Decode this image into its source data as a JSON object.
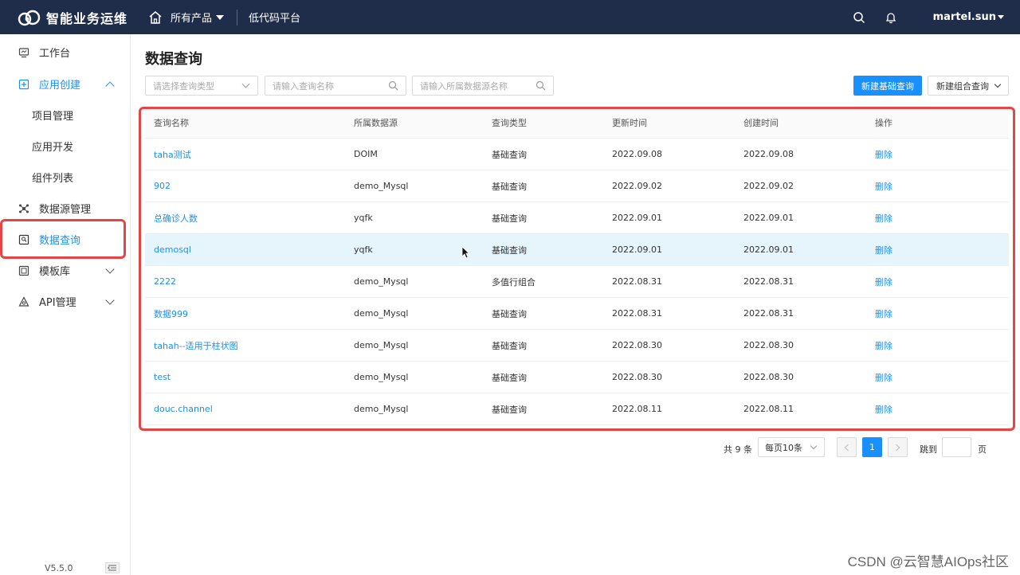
{
  "topbar": {
    "brand": "智能业务运维",
    "products": "所有产品",
    "platform": "低代码平台",
    "username": "martel.sun",
    "bg_color": "#1f2d4a"
  },
  "sidebar": {
    "items": [
      {
        "label": "工作台",
        "icon": "monitor-icon"
      },
      {
        "label": "应用创建",
        "icon": "app-create-icon"
      },
      {
        "label": "项目管理"
      },
      {
        "label": "应用开发"
      },
      {
        "label": "组件列表"
      },
      {
        "label": "数据源管理",
        "icon": "datasource-icon"
      },
      {
        "label": "数据查询",
        "icon": "data-query-icon"
      },
      {
        "label": "模板库",
        "icon": "template-icon"
      },
      {
        "label": "API管理",
        "icon": "api-icon"
      }
    ],
    "version": "V5.5.0"
  },
  "main": {
    "title": "数据查询",
    "filters": {
      "type_placeholder": "请选择查询类型",
      "name_placeholder": "请输入查询名称",
      "source_placeholder": "请输入所属数据源名称"
    },
    "buttons": {
      "new_basic": "新建基础查询",
      "new_combo": "新建组合查询"
    },
    "table": {
      "headers": [
        "查询名称",
        "所属数据源",
        "查询类型",
        "更新时间",
        "创建时间",
        "操作"
      ],
      "rows": [
        {
          "name": "taha测试",
          "source": "DOIM",
          "type": "基础查询",
          "updated": "2022.09.08",
          "created": "2022.09.08",
          "action": "删除"
        },
        {
          "name": "902",
          "source": "demo_Mysql",
          "type": "基础查询",
          "updated": "2022.09.02",
          "created": "2022.09.02",
          "action": "删除"
        },
        {
          "name": "总确诊人数",
          "source": "yqfk",
          "type": "基础查询",
          "updated": "2022.09.01",
          "created": "2022.09.01",
          "action": "删除"
        },
        {
          "name": "demosql",
          "source": "yqfk",
          "type": "基础查询",
          "updated": "2022.09.01",
          "created": "2022.09.01",
          "action": "删除"
        },
        {
          "name": "2222",
          "source": "demo_Mysql",
          "type": "多值行组合",
          "updated": "2022.08.31",
          "created": "2022.08.31",
          "action": "删除"
        },
        {
          "name": "数据999",
          "source": "demo_Mysql",
          "type": "基础查询",
          "updated": "2022.08.31",
          "created": "2022.08.31",
          "action": "删除"
        },
        {
          "name": "tahah--适用于柱状图",
          "source": "demo_Mysql",
          "type": "基础查询",
          "updated": "2022.08.30",
          "created": "2022.08.30",
          "action": "删除"
        },
        {
          "name": "test",
          "source": "demo_Mysql",
          "type": "基础查询",
          "updated": "2022.08.30",
          "created": "2022.08.30",
          "action": "删除"
        },
        {
          "name": "douc.channel",
          "source": "demo_Mysql",
          "type": "基础查询",
          "updated": "2022.08.11",
          "created": "2022.08.11",
          "action": "删除"
        }
      ]
    },
    "pagination": {
      "total": "共 9 条",
      "page_size": "每页10条",
      "current": "1",
      "jump_label": "跳到",
      "page_label": "页"
    }
  },
  "watermark": "CSDN @云智慧AIOps社区",
  "colors": {
    "accent": "#1890ff",
    "highlight": "#e64545"
  }
}
